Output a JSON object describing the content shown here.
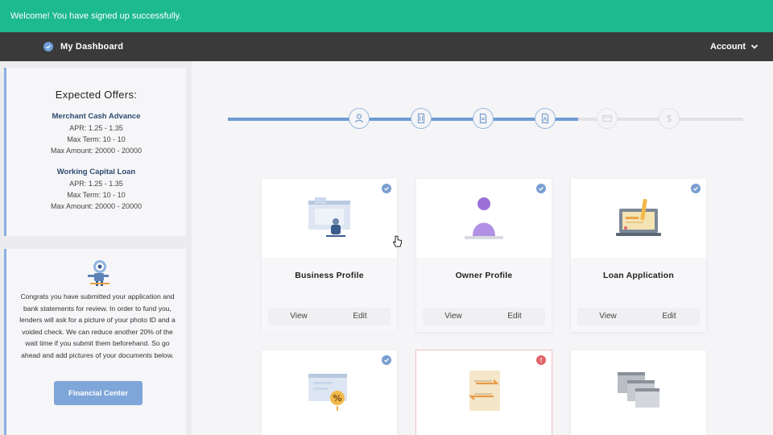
{
  "banner": {
    "text": "Welcome! You have signed up successfully."
  },
  "header": {
    "title": "My Dashboard",
    "account_label": "Account"
  },
  "sidebar": {
    "offers_title": "Expected Offers:",
    "offers": [
      {
        "name": "Merchant Cash Advance",
        "apr": "APR: 1.25 - 1.35",
        "term": "Max Term: 10 - 10",
        "amount": "Max Amount: 20000 - 20000"
      },
      {
        "name": "Working Capital Loan",
        "apr": "APR: 1.25 - 1.35",
        "term": "Max Term: 10 - 10",
        "amount": "Max Amount: 20000 - 20000"
      }
    ],
    "congrats_text": "Congrats you have submitted your application and bank statements for review. In order to fund you, lenders will ask for a picture of your photo ID and a voided check. We can reduce another 20% of the wait time if you submit them beforehand. So go ahead and add pictures of your documents below.",
    "financial_center_label": "Financial Center"
  },
  "progress": {
    "completed_steps": 4,
    "total_steps": 6,
    "steps": [
      {
        "icon": "user-icon",
        "status": "done"
      },
      {
        "icon": "building-icon",
        "status": "done"
      },
      {
        "icon": "document-icon",
        "status": "done"
      },
      {
        "icon": "pdf-icon",
        "status": "done"
      },
      {
        "icon": "card-icon",
        "status": "pending"
      },
      {
        "icon": "dollar-icon",
        "status": "pending"
      }
    ],
    "colors": {
      "done": "#6e9bd1",
      "pending": "#e2e2e6"
    }
  },
  "cards": [
    {
      "title": "Business Profile",
      "view": "View",
      "edit": "Edit",
      "status": "complete",
      "icon": "business-profile-icon"
    },
    {
      "title": "Owner Profile",
      "view": "View",
      "edit": "Edit",
      "status": "complete",
      "icon": "owner-profile-icon"
    },
    {
      "title": "Loan Application",
      "view": "View",
      "edit": "Edit",
      "status": "complete",
      "icon": "loan-application-icon"
    },
    {
      "title": "",
      "status": "complete",
      "icon": "rates-document-icon"
    },
    {
      "title": "",
      "status": "alert",
      "badge_text": "!",
      "icon": "transfer-document-icon"
    },
    {
      "title": "",
      "status": "none",
      "icon": "browser-windows-icon"
    }
  ],
  "colors": {
    "banner": "#1db98f",
    "topbar": "#3a3a3a",
    "accent": "#7ea6d8",
    "alert": "#e0646b"
  }
}
